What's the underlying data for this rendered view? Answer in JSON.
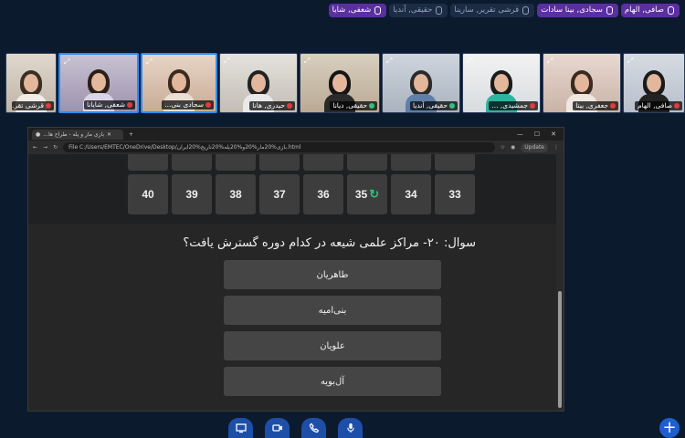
{
  "chips": [
    {
      "label": "صافی, الهام",
      "speaking": true
    },
    {
      "label": "سجادی, بینا سادات",
      "speaking": true
    },
    {
      "label": "قرشی تقریر, سارینا",
      "speaking": false
    },
    {
      "label": "حقیقی, آندیا",
      "speaking": false
    },
    {
      "label": "شعفی, شایا",
      "speaking": true
    }
  ],
  "participants": [
    {
      "name": "صافی, الهام",
      "mic_on": false,
      "active": false
    },
    {
      "name": "جعفری, بیتا",
      "mic_on": false,
      "active": false
    },
    {
      "name": "جمشیدی, ...",
      "mic_on": false,
      "active": false
    },
    {
      "name": "حقیقی, آندیا",
      "mic_on": true,
      "active": false
    },
    {
      "name": "حقیقی, دیانا",
      "mic_on": true,
      "active": false
    },
    {
      "name": "حیدری, هانا",
      "mic_on": false,
      "active": false
    },
    {
      "name": "سجادی بنی...",
      "mic_on": false,
      "active": true
    },
    {
      "name": "شعفی, شایانا",
      "mic_on": false,
      "active": true
    },
    {
      "name": "قرشی تقر...",
      "mic_on": false,
      "active": false
    }
  ],
  "browser": {
    "tab_title": "بازی مار و پله - طراح ها...",
    "url": "File  C:/Users/EMTEC/OneDrive/Desktop/بازی%20مار%20و%20پله%20تاریخ%20ایران.html",
    "update_label": "Update"
  },
  "board": {
    "top_row": [
      "",
      "",
      "",
      "",
      "",
      "",
      "",
      ""
    ],
    "row": [
      "33",
      "34",
      "35",
      "36",
      "37",
      "38",
      "39",
      "40"
    ],
    "marked_index": 2
  },
  "question": {
    "text": "سوال: ۲۰- مراکز علمی شیعه در کدام دوره گسترش یافت؟",
    "options": [
      "طاهریان",
      "بنی‌امیه",
      "علویان",
      "آل‌بویه"
    ]
  },
  "colors": {
    "accent": "#5b2fa0",
    "control_blue": "#1e4fa8",
    "marker_green": "#2ec27e"
  }
}
